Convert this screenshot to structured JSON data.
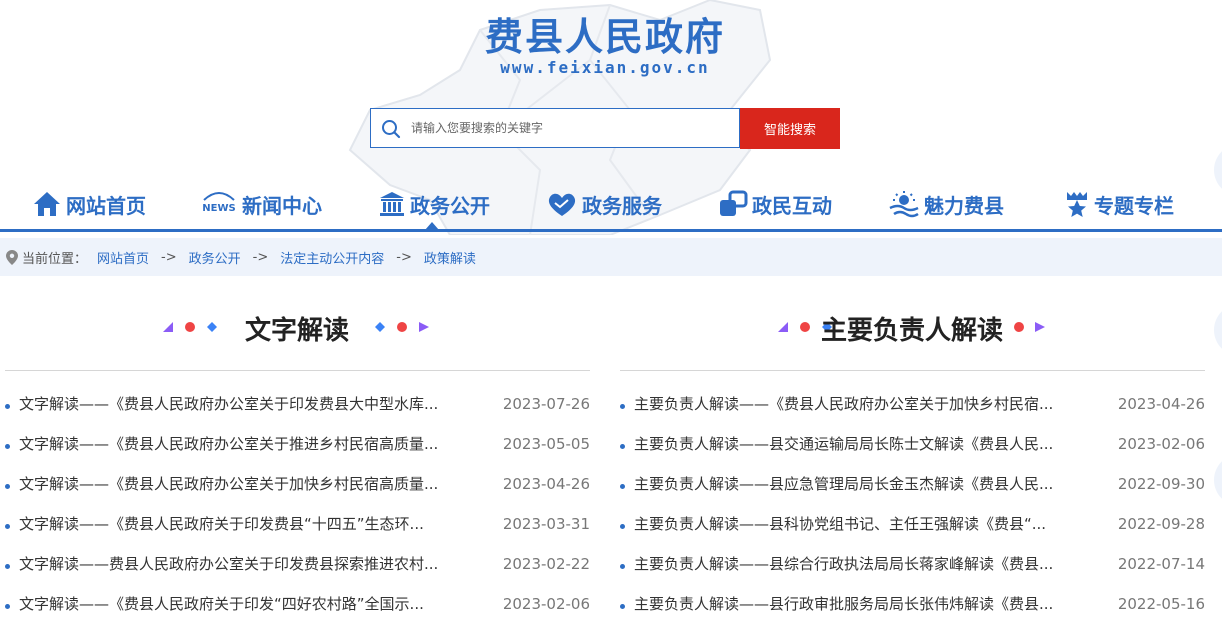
{
  "header": {
    "title": "费县人民政府",
    "url": "www.feixian.gov.cn"
  },
  "search": {
    "placeholder": "请输入您要搜索的关键字",
    "button_label": "智能搜索"
  },
  "nav": {
    "items": [
      {
        "label": "网站首页",
        "icon": "home-icon"
      },
      {
        "label": "新闻中心",
        "icon": "news-icon",
        "icon_text": "NEWS"
      },
      {
        "label": "政务公开",
        "icon": "government-building-icon",
        "active": true
      },
      {
        "label": "政务服务",
        "icon": "heart-hands-icon"
      },
      {
        "label": "政民互动",
        "icon": "interaction-icon"
      },
      {
        "label": "魅力费县",
        "icon": "scenery-icon"
      },
      {
        "label": "专题专栏",
        "icon": "star-ribbon-icon"
      }
    ],
    "accent_color": "#2d6dc4"
  },
  "breadcrumb": {
    "prefix": "当前位置：",
    "items": [
      "网站首页",
      "政务公开",
      "法定主动公开内容",
      "政策解读"
    ],
    "separator": "->"
  },
  "sections": [
    {
      "title": "文字解读",
      "items": [
        {
          "title": "文字解读——《费县人民政府办公室关于印发费县大中型水库...",
          "date": "2023-07-26"
        },
        {
          "title": "文字解读——《费县人民政府办公室关于推进乡村民宿高质量...",
          "date": "2023-05-05"
        },
        {
          "title": "文字解读——《费县人民政府办公室关于加快乡村民宿高质量...",
          "date": "2023-04-26"
        },
        {
          "title": "文字解读——《费县人民政府关于印发费县“十四五”生态环...",
          "date": "2023-03-31"
        },
        {
          "title": "文字解读——费县人民政府办公室关于印发费县探索推进农村...",
          "date": "2023-02-22"
        },
        {
          "title": "文字解读——《费县人民政府关于印发“四好农村路”全国示...",
          "date": "2023-02-06"
        }
      ]
    },
    {
      "title": "主要负责人解读",
      "items": [
        {
          "title": "主要负责人解读——《费县人民政府办公室关于加快乡村民宿...",
          "date": "2023-04-26"
        },
        {
          "title": "主要负责人解读——县交通运输局局长陈士文解读《费县人民...",
          "date": "2023-02-06"
        },
        {
          "title": "主要负责人解读——县应急管理局局长金玉杰解读《费县人民...",
          "date": "2022-09-30"
        },
        {
          "title": "主要负责人解读——县科协党组书记、主任王强解读《费县“...",
          "date": "2022-09-28"
        },
        {
          "title": "主要负责人解读——县综合行政执法局局长蒋家峰解读《费县...",
          "date": "2022-07-14"
        },
        {
          "title": "主要负责人解读——县行政审批服务局局长张伟炜解读《费县...",
          "date": "2022-05-16"
        }
      ]
    }
  ],
  "colors": {
    "brand_blue": "#2d6dc4",
    "search_red": "#d9261c",
    "breadcrumb_bg": "#eef3fb"
  }
}
